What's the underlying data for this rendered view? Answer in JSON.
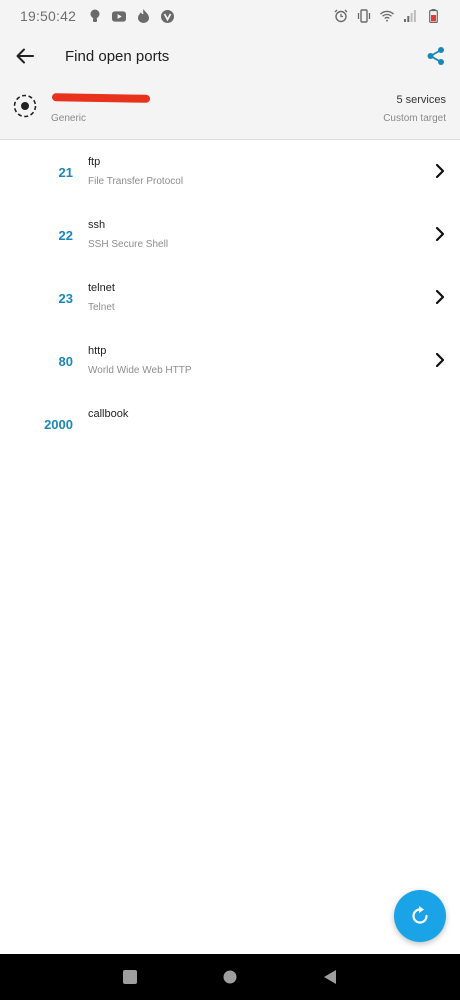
{
  "status_bar": {
    "time": "19:50:42",
    "left_icons": [
      "bulb-icon",
      "youtube-icon",
      "flame-icon",
      "vivaldi-icon"
    ],
    "right_icons": [
      "alarm-icon",
      "vibrate-icon",
      "wifi-icon",
      "signal-icon",
      "battery-icon"
    ]
  },
  "app_bar": {
    "title": "Find open ports"
  },
  "target": {
    "type": "Generic",
    "service_count": "5 services",
    "kind": "Custom target"
  },
  "ports": [
    {
      "number": "21",
      "name": "ftp",
      "description": "File Transfer Protocol",
      "has_chevron": true
    },
    {
      "number": "22",
      "name": "ssh",
      "description": "SSH Secure Shell",
      "has_chevron": true
    },
    {
      "number": "23",
      "name": "telnet",
      "description": "Telnet",
      "has_chevron": true
    },
    {
      "number": "80",
      "name": "http",
      "description": "World Wide Web HTTP",
      "has_chevron": true
    },
    {
      "number": "2000",
      "name": "callbook",
      "description": "",
      "has_chevron": false
    }
  ],
  "colors": {
    "accent": "#1b87b9",
    "fab": "#1aa3e6",
    "redaction": "#e8321e",
    "header_bg": "#f4f4f4"
  }
}
